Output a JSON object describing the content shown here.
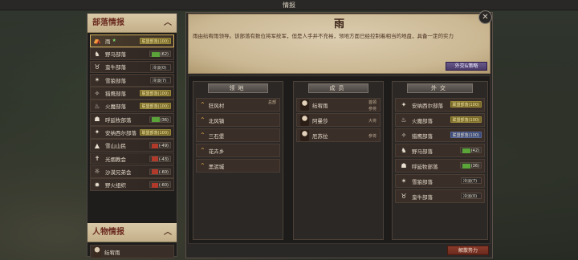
{
  "window": {
    "title": "情报"
  },
  "left": {
    "tribe_header": "部落情报",
    "tribes": [
      {
        "name": "雨",
        "icon": "tent-icon",
        "star": "★",
        "badge": "联盟部落(100)",
        "badge_type": "tag",
        "selected": true
      },
      {
        "name": "野马部落",
        "icon": "horse-icon",
        "badge": "(62)",
        "badge_type": "bar-green"
      },
      {
        "name": "蛮牛部落",
        "icon": "ox-icon",
        "badge": "冷淡(0)",
        "badge_type": "neutral"
      },
      {
        "name": "雪狼部落",
        "icon": "wolf-icon",
        "badge": "冷淡(7)",
        "badge_type": "neutral"
      },
      {
        "name": "猎鹰部落",
        "icon": "eagle-icon",
        "badge": "联盟部落(100)",
        "badge_type": "tag"
      },
      {
        "name": "火魔部落",
        "icon": "flame-icon",
        "badge": "联盟部落(100)",
        "badge_type": "tag"
      },
      {
        "name": "呼延牧部落",
        "icon": "shepherd-icon",
        "badge": "(36)",
        "badge_type": "bar-green"
      },
      {
        "name": "安纳西尔部落",
        "icon": "nomad-icon",
        "badge": "联盟部落(100)",
        "badge_type": "tag"
      },
      {
        "name": "雪山山民",
        "icon": "mountain-icon",
        "badge": "(-49)",
        "badge_type": "bar-red"
      },
      {
        "name": "光烟教会",
        "icon": "church-icon",
        "badge": "(-43)",
        "badge_type": "bar-red"
      },
      {
        "name": "沙漠兄弟会",
        "icon": "desert-icon",
        "badge": "(-60)",
        "badge_type": "bar-red"
      },
      {
        "name": "野火组织",
        "icon": "fire-icon",
        "badge": "(-60)",
        "badge_type": "bar-red"
      }
    ],
    "person_header": "人物情报",
    "persons": [
      {
        "name": "纭宥雨"
      }
    ]
  },
  "detail": {
    "title": "雨",
    "description": "雨由纭宥雨领导。该部落有数位将军统军，但是人手并不充裕，领地方面已经控制着相当的地盘，具备一定的实力",
    "diplomacy_button": "外交&策略",
    "close_label": "✕",
    "territory_header": "领地",
    "territories": [
      {
        "name": "狂风村",
        "tag": "总部"
      },
      {
        "name": "北风镇"
      },
      {
        "name": "三石堡"
      },
      {
        "name": "花卉乡"
      },
      {
        "name": "黑泥城"
      }
    ],
    "members_header": "成员",
    "members": [
      {
        "name": "纭宥雨",
        "tag": "首领",
        "role": "参将"
      },
      {
        "name": "阿曼莎",
        "role": "大将"
      },
      {
        "name": "厄苏拉",
        "role": "参将"
      }
    ],
    "diplomacy_header": "外交",
    "relations": [
      {
        "name": "安纳西尔部落",
        "icon": "nomad-icon",
        "badge": "联盟部落(100)",
        "badge_type": "tag"
      },
      {
        "name": "火魔部落",
        "icon": "flame-icon",
        "badge": "联盟部落(100)",
        "badge_type": "tag"
      },
      {
        "name": "猎鹰部落",
        "icon": "eagle-icon",
        "badge": "联盟部落(100)",
        "badge_type": "bar-blue"
      },
      {
        "name": "野马部落",
        "icon": "horse-icon",
        "badge": "(42)",
        "badge_type": "bar-green"
      },
      {
        "name": "呼延牧部落",
        "icon": "shepherd-icon",
        "badge": "(36)",
        "badge_type": "bar-green"
      },
      {
        "name": "雪狼部落",
        "icon": "wolf-icon",
        "badge": "冷淡(7)",
        "badge_type": "neutral"
      },
      {
        "name": "蛮牛部落",
        "icon": "ox-icon",
        "badge": "冷淡(0)",
        "badge_type": "neutral"
      }
    ],
    "dissolve_button": "解散势力"
  }
}
